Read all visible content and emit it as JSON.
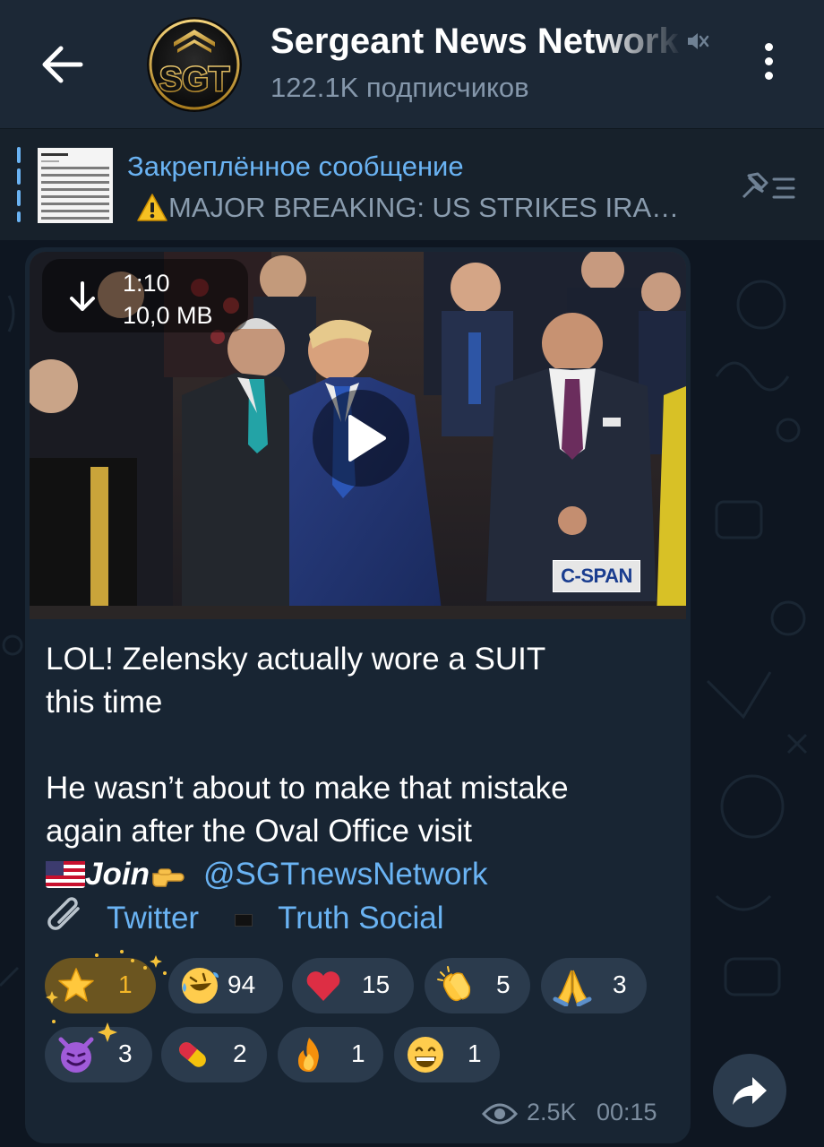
{
  "header": {
    "avatar_text": "SGT",
    "title": "Sergeant News Network",
    "subscribers": "122.1K подписчиков"
  },
  "pinned": {
    "title": "Закреплённое сообщение",
    "text": "MAJOR BREAKING: US STRIKES IRA…"
  },
  "message": {
    "video": {
      "duration": "1:10",
      "size": "10,0 MB",
      "watermark": "C-SPAN"
    },
    "text": "LOL! Zelensky actually wore a SUIT\nthis time\n\nHe wasn’t about to make that mistake\nagain after the Oval Office visit",
    "join_label": "Join",
    "channel_link": "@SGTnewsNetwork",
    "twitter_label": "Twitter",
    "truth_label": "Truth Social",
    "reactions": [
      {
        "emoji": "star",
        "count": "1"
      },
      {
        "emoji": "rofl",
        "count": "94"
      },
      {
        "emoji": "heart",
        "count": "15"
      },
      {
        "emoji": "clap",
        "count": "5"
      },
      {
        "emoji": "pray",
        "count": "3"
      },
      {
        "emoji": "smiling-imp",
        "count": "3"
      },
      {
        "emoji": "pill",
        "count": "2"
      },
      {
        "emoji": "fire",
        "count": "1"
      },
      {
        "emoji": "grin",
        "count": "1"
      }
    ],
    "views": "2.5K",
    "time": "00:15"
  },
  "colors": {
    "background": "#0e1621",
    "header": "#1c2836",
    "bubble": "#182533",
    "accent": "#6ab3f3",
    "reaction_bg": "#2b3b4d",
    "reaction_active": "#6b5520"
  }
}
